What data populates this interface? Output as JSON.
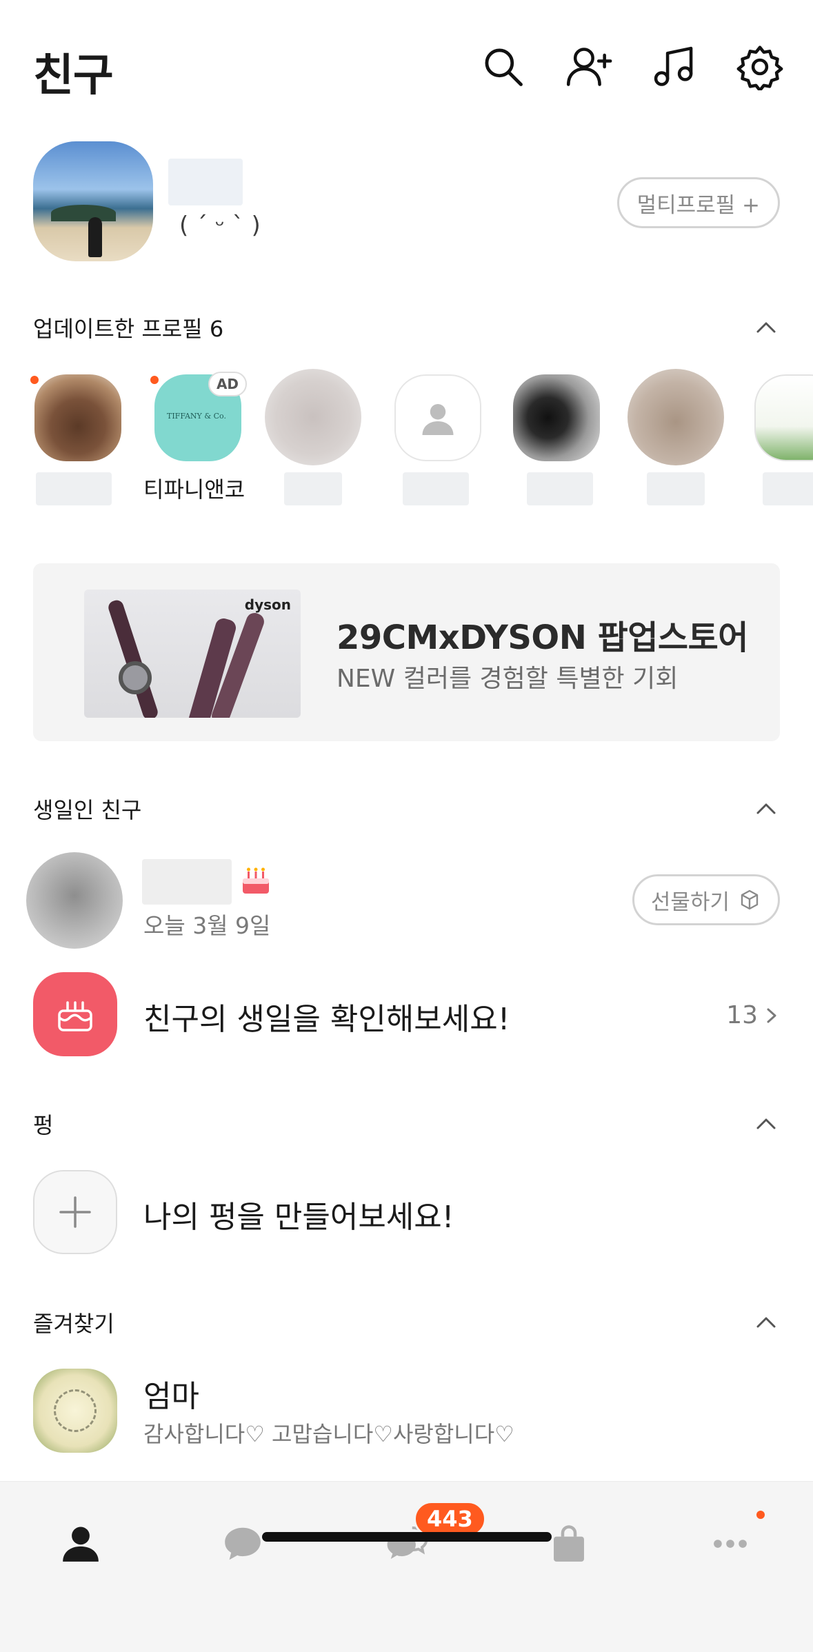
{
  "header": {
    "title": "친구",
    "icons": [
      "search-icon",
      "add-friend-icon",
      "music-icon",
      "settings-icon"
    ]
  },
  "my_profile": {
    "status_message": "( ˊ ᵕ ˋ )",
    "multi_profile_label": "멀티프로필 +"
  },
  "updated_profiles": {
    "title": "업데이트한 프로필 6",
    "items": [
      {
        "name": "",
        "has_new": true
      },
      {
        "name": "티파니앤코",
        "has_new": true,
        "ad_label": "AD",
        "logo_text": "TIFFANY & Co."
      },
      {
        "name": "",
        "has_new": false
      },
      {
        "name": "",
        "has_new": false
      },
      {
        "name": "",
        "has_new": false
      },
      {
        "name": "",
        "has_new": false
      },
      {
        "name": "",
        "has_new": false
      }
    ]
  },
  "ad_banner": {
    "brand": "dyson",
    "title": "29CMxDYSON 팝업스토어",
    "subtitle": "NEW 컬러를 경험할 특별한 기회"
  },
  "birthday": {
    "title": "생일인 친구",
    "friend_date": "오늘 3월 9일",
    "gift_label": "선물하기",
    "check_text": "친구의 생일을 확인해보세요!",
    "check_count": "13"
  },
  "pung": {
    "title": "펑",
    "create_text": "나의 펑을 만들어보세요!"
  },
  "favorites": {
    "title": "즐겨찾기",
    "items": [
      {
        "name": "엄마",
        "status": "감사합니다♡ 고맙습니다♡사랑합니다♡"
      }
    ]
  },
  "tabbar": {
    "tabs": [
      "friends-tab",
      "chats-tab",
      "open-chat-tab",
      "shopping-tab",
      "more-tab"
    ],
    "open_chat_badge": "443"
  },
  "colors": {
    "accent": "#ff5a1f",
    "birthday_icon": "#f25a68"
  }
}
